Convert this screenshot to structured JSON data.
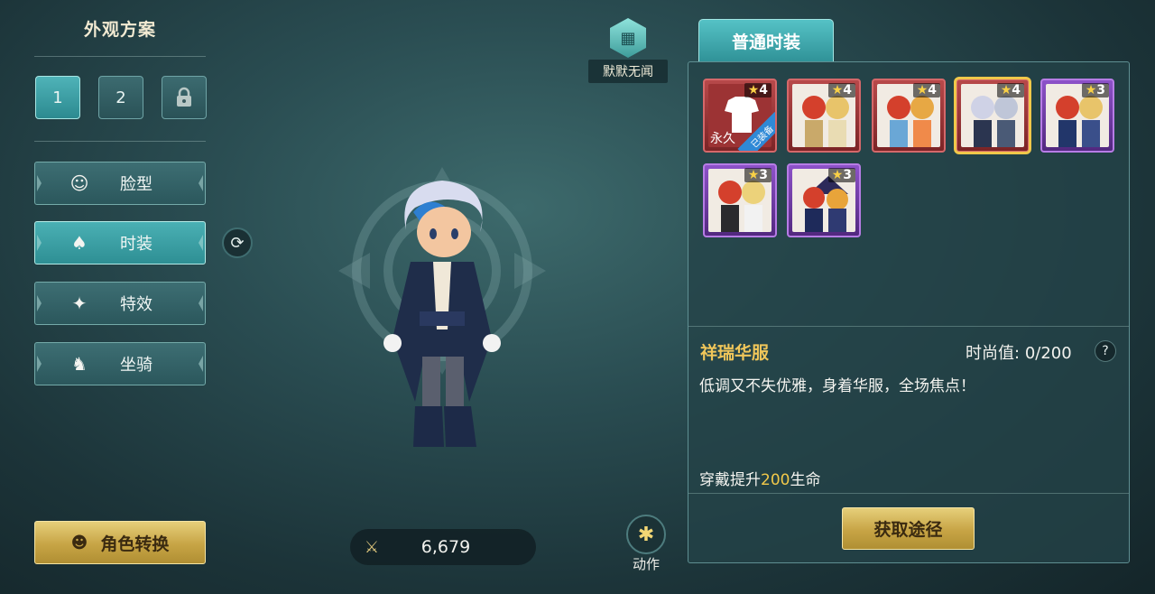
{
  "left": {
    "title": "外观方案",
    "slots": [
      "1",
      "2"
    ],
    "menu": [
      {
        "label": "脸型",
        "icon": "face-icon",
        "glyph": "☺"
      },
      {
        "label": "时装",
        "icon": "outfit-icon",
        "glyph": "♠"
      },
      {
        "label": "特效",
        "icon": "sparkle-icon",
        "glyph": "✦"
      },
      {
        "label": "坐骑",
        "icon": "mount-icon",
        "glyph": "♞"
      }
    ],
    "role_switch": "角色转换"
  },
  "center": {
    "title_badge": "默默无闻",
    "power": "6,679",
    "action_label": "动作"
  },
  "right": {
    "tab": "普通时装",
    "items": [
      {
        "stars": "4",
        "rarity": "red",
        "perm": "永久",
        "equipped": "已装备"
      },
      {
        "stars": "4",
        "rarity": "red"
      },
      {
        "stars": "4",
        "rarity": "red"
      },
      {
        "stars": "4",
        "rarity": "red",
        "selected": true
      },
      {
        "stars": "3",
        "rarity": "purple"
      },
      {
        "stars": "3",
        "rarity": "purple"
      },
      {
        "stars": "3",
        "rarity": "purple"
      }
    ],
    "detail": {
      "name": "祥瑞华服",
      "fashion_label": "时尚值:",
      "fashion_value": "0/200",
      "help": "?",
      "description": "低调又不失优雅，身着华服，全场焦点！",
      "bonus_prefix": "穿戴提升",
      "bonus_value": "200",
      "bonus_suffix": "生命"
    },
    "acquire_button": "获取途径"
  },
  "colors": {
    "accent": "#3aa6ab",
    "gold": "#d2b254",
    "highlight": "#f0c65a"
  }
}
